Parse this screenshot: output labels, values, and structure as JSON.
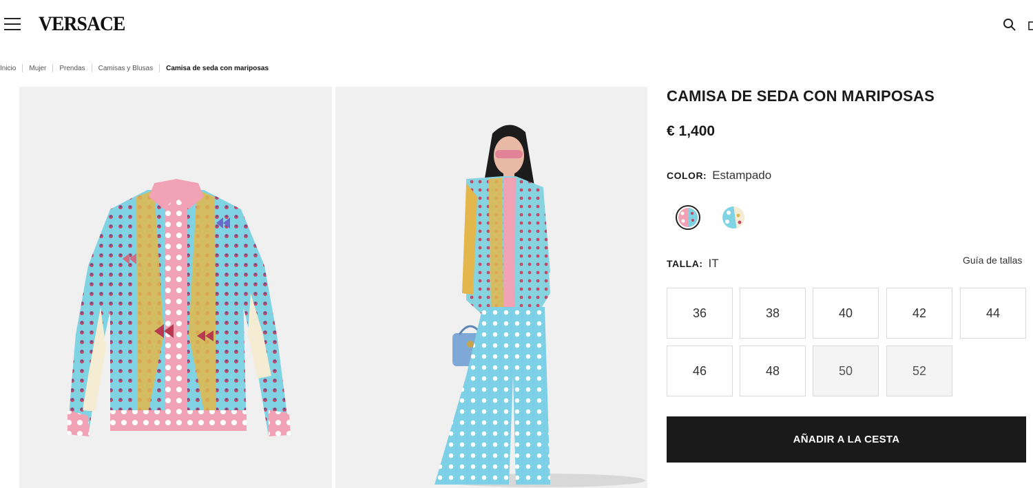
{
  "header": {
    "logo": "VERSACE",
    "icons": [
      "menu-icon",
      "search-icon",
      "bag-icon"
    ]
  },
  "breadcrumb": {
    "items": [
      "Inicio",
      "Mujer",
      "Prendas",
      "Camisas y Blusas"
    ],
    "current": "Camisa de seda con mariposas"
  },
  "product": {
    "title": "CAMISA DE SEDA CON MARIPOSAS",
    "price": "€ 1,400",
    "color_label": "COLOR:",
    "color_value": "Estampado",
    "size_label": "TALLA:",
    "size_system": "IT",
    "size_guide": "Guía de tallas",
    "sizes": [
      {
        "label": "36",
        "available": true
      },
      {
        "label": "38",
        "available": true
      },
      {
        "label": "40",
        "available": true
      },
      {
        "label": "42",
        "available": true
      },
      {
        "label": "44",
        "available": true
      },
      {
        "label": "46",
        "available": true
      },
      {
        "label": "48",
        "available": true
      },
      {
        "label": "50",
        "available": false
      },
      {
        "label": "52",
        "available": false
      }
    ],
    "add_to_cart": "AÑADIR A LA CESTA",
    "swatches": [
      "pink-polka-dot-print",
      "turquoise-butterfly-print"
    ]
  },
  "colors": {
    "brand_black": "#1a1a1a",
    "turquoise": "#7fd3e3",
    "pink": "#f2a2b5",
    "gold": "#e3b74c"
  }
}
